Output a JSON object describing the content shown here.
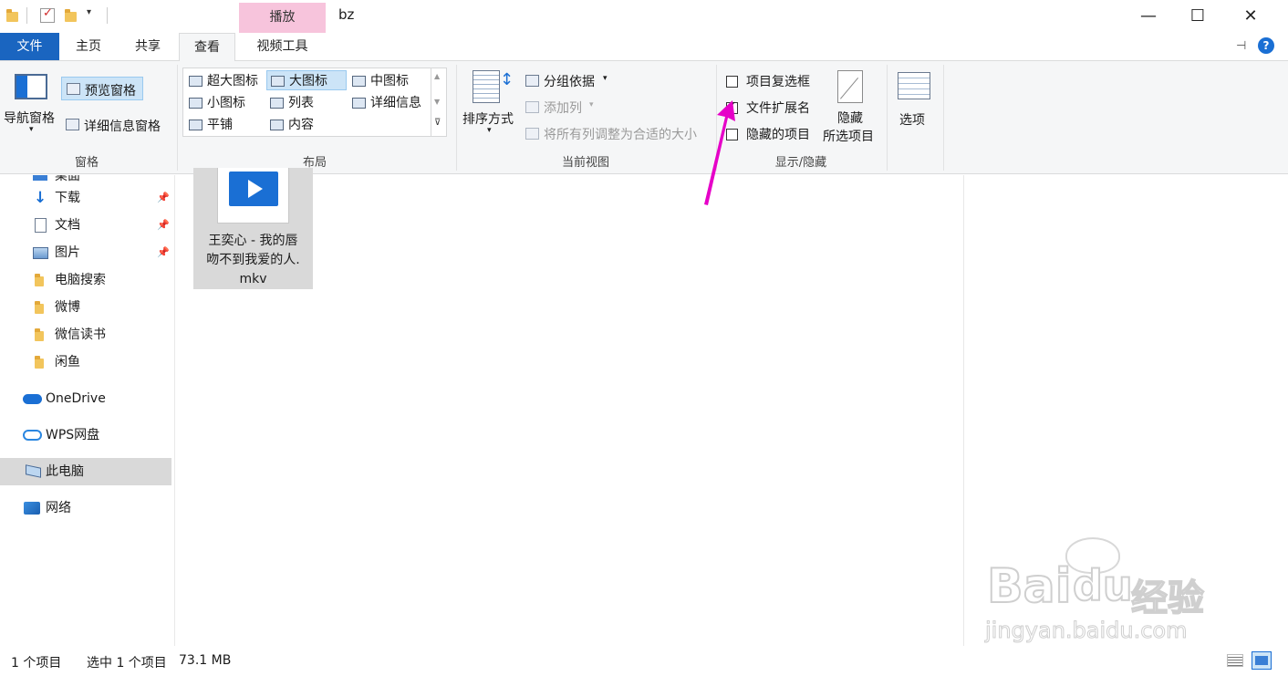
{
  "window": {
    "title": "bz",
    "context_tab": "播放",
    "controls": {
      "minimize": "—",
      "maximize": "☐",
      "close": "✕"
    }
  },
  "tabs": {
    "file": "文件",
    "home": "主页",
    "share": "共享",
    "view": "查看",
    "video_tools": "视频工具"
  },
  "ribbon": {
    "panes": {
      "nav_pane": "导航窗格",
      "preview_pane": "预览窗格",
      "details_pane": "详细信息窗格",
      "group_label": "窗格"
    },
    "layout": {
      "items": [
        "超大图标",
        "大图标",
        "中图标",
        "小图标",
        "列表",
        "详细信息",
        "平铺",
        "内容"
      ],
      "selected": "大图标",
      "group_label": "布局"
    },
    "current_view": {
      "sort_by": "排序方式",
      "group_by": "分组依据",
      "add_column": "添加列",
      "size_columns": "将所有列调整为合适的大小",
      "group_label": "当前视图"
    },
    "show_hide": {
      "item_checkboxes": {
        "label": "项目复选框",
        "checked": false
      },
      "file_extensions": {
        "label": "文件扩展名",
        "checked": true
      },
      "hidden_items": {
        "label": "隐藏的项目",
        "checked": false
      },
      "hide_selected_line1": "隐藏",
      "hide_selected_line2": "所选项目",
      "group_label": "显示/隐藏"
    },
    "options": "选项"
  },
  "nav": {
    "partial_top": "桌面",
    "items": [
      {
        "label": "下载",
        "pinned": true
      },
      {
        "label": "文档",
        "pinned": true
      },
      {
        "label": "图片",
        "pinned": true
      },
      {
        "label": "电脑搜索"
      },
      {
        "label": "微博"
      },
      {
        "label": "微信读书"
      },
      {
        "label": "闲鱼"
      },
      {
        "label": "OneDrive"
      },
      {
        "label": "WPS网盘"
      },
      {
        "label": "此电脑",
        "selected": true
      },
      {
        "label": "网络"
      }
    ]
  },
  "files": [
    {
      "name_line1": "王奕心 - 我的唇",
      "name_line2": "吻不到我爱的人.",
      "name_line3": "mkv",
      "type": "video"
    }
  ],
  "status": {
    "item_count": "1 个项目",
    "selected": "选中 1 个项目",
    "size": "73.1 MB"
  },
  "watermark": {
    "brand": "Bai",
    "brand2": "du",
    "cn": "经验",
    "url": "jingyan.baidu.com"
  },
  "colors": {
    "accent": "#1a65c0",
    "context_tab": "#f7c4dc",
    "arrow": "#e600c8"
  }
}
